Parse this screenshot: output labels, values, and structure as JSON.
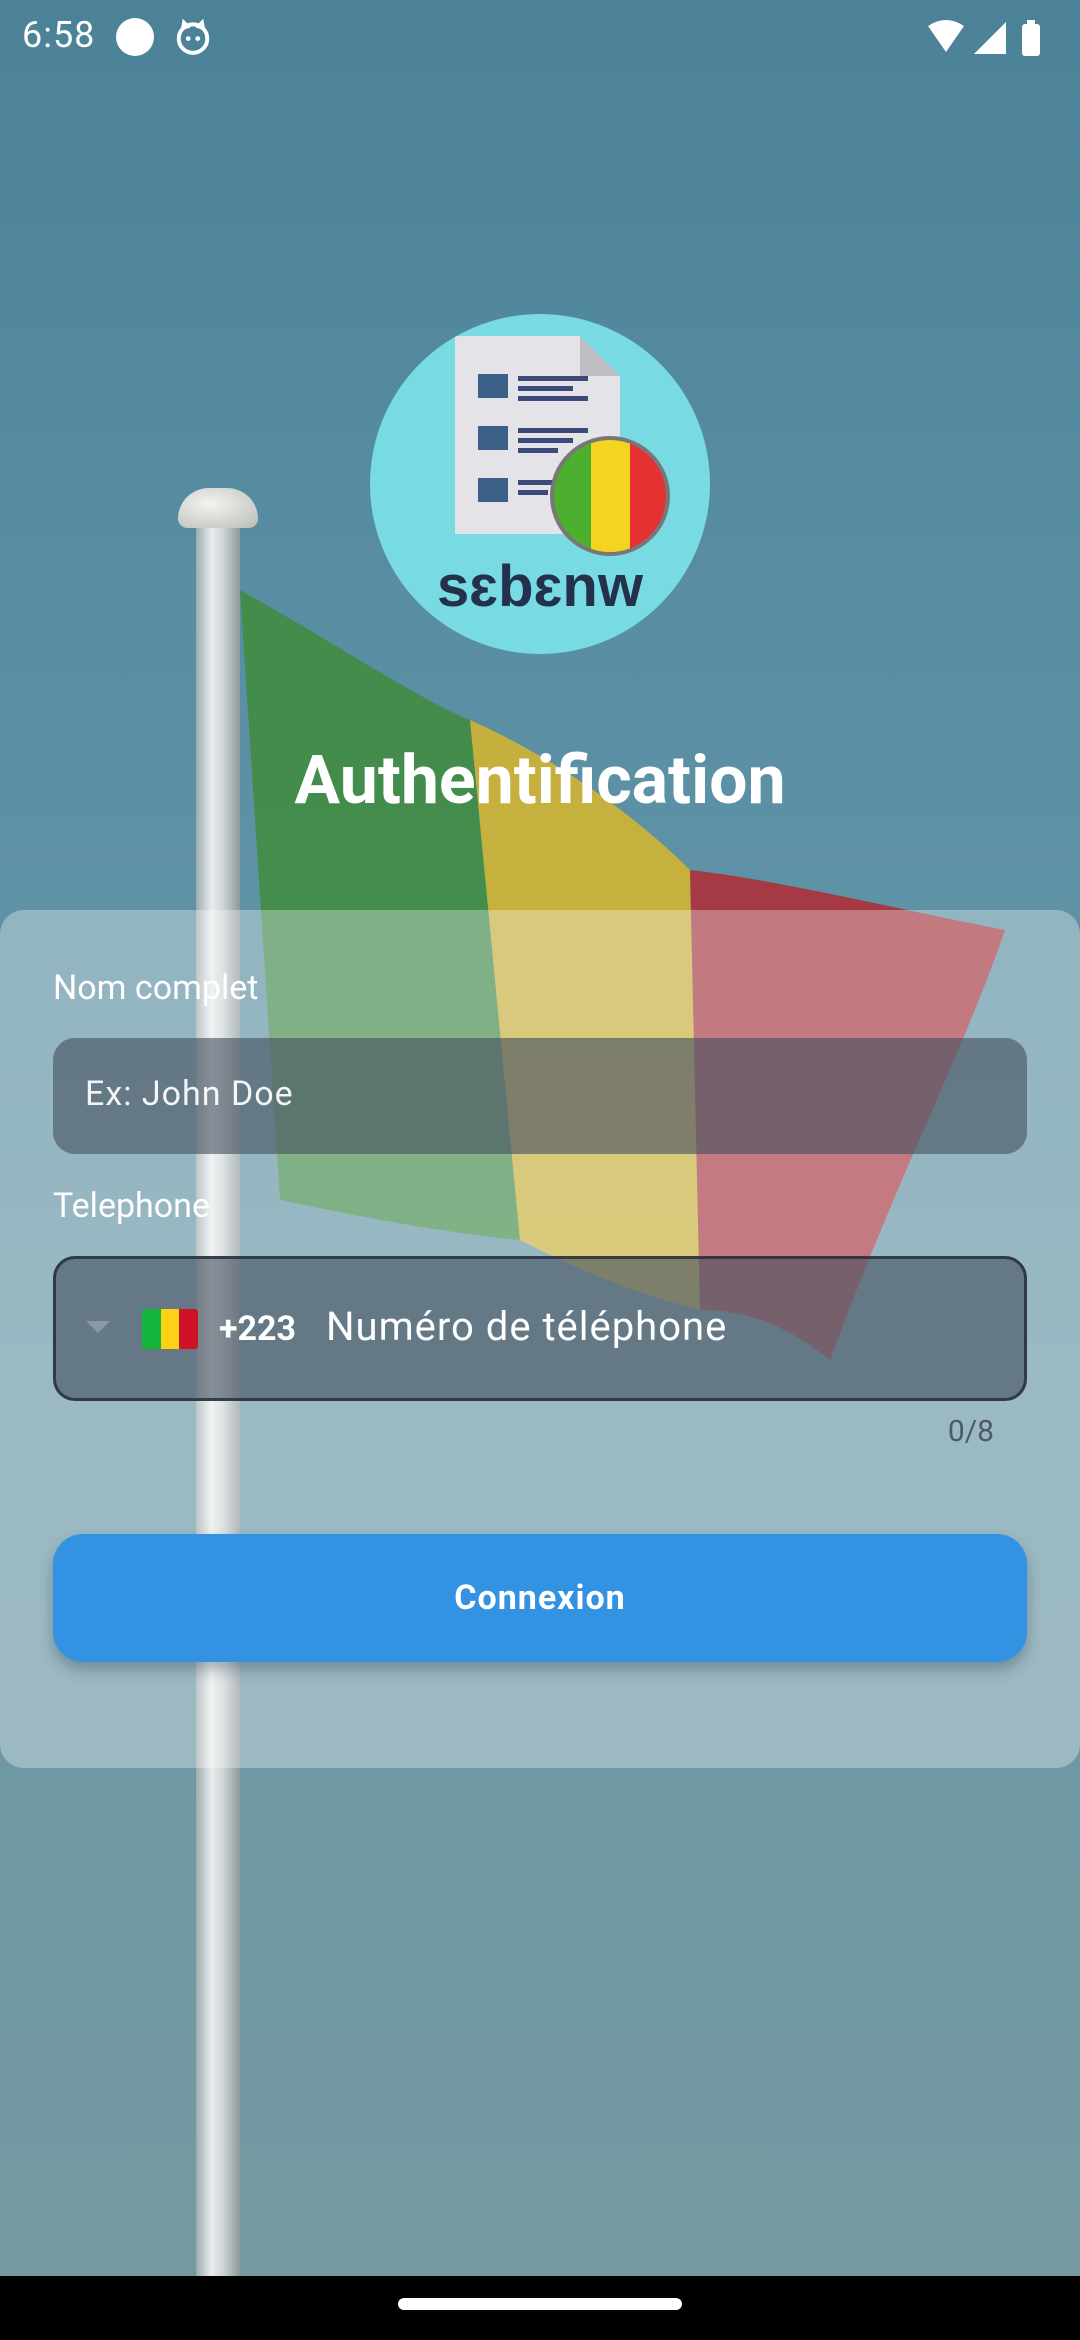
{
  "status_bar": {
    "time": "6:58"
  },
  "logo": {
    "text": "sɛbɛnw"
  },
  "title": "Authentification",
  "form": {
    "name_label": "Nom complet",
    "name_placeholder": "Ex: John Doe",
    "phone_label": "Telephone",
    "country_code": "+223",
    "phone_placeholder": "Numéro de téléphone",
    "counter": "0/8",
    "submit_label": "Connexion"
  },
  "colors": {
    "accent": "#3392e1",
    "mali_green": "#14b53a",
    "mali_yellow": "#fcd116",
    "mali_red": "#ce1126",
    "logo_bg": "#78dbe4"
  },
  "icons": {
    "country_dropdown": "caret-down-icon",
    "country_flag": "mali-flag-icon"
  }
}
